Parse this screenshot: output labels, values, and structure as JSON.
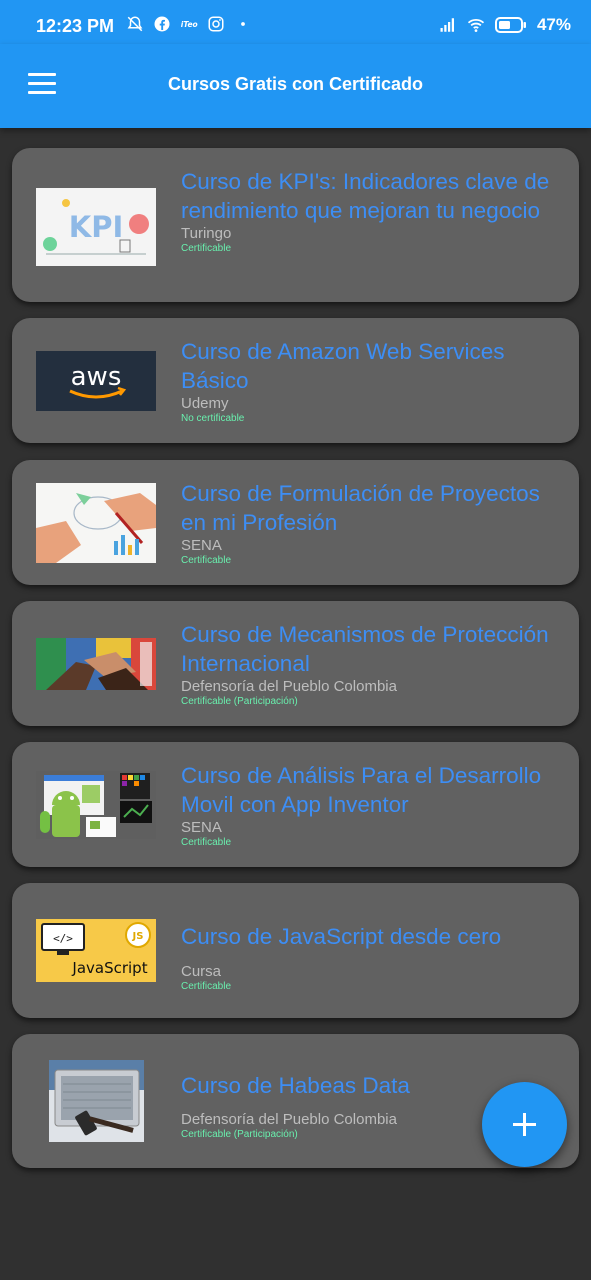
{
  "status_bar": {
    "time": "12:23 PM",
    "left_icons": [
      "notifications-off-icon",
      "facebook-icon",
      "app-notification-icon",
      "instagram-icon",
      "dot-icon"
    ],
    "right_icons": [
      "signal-icon",
      "wifi-icon",
      "battery-icon"
    ],
    "battery": "47%"
  },
  "app_bar": {
    "title": "Cursos Gratis con Certificado",
    "menu_icon": "menu-icon"
  },
  "courses": [
    {
      "title": "Curso de KPI's: Indicadores clave de rendimiento que mejoran tu negocio",
      "provider": "Turingo",
      "certification": "Certificable",
      "thumbnail_text": "KPI"
    },
    {
      "title": "Curso de Amazon Web Services Básico",
      "provider": "Udemy",
      "certification": "No certificable",
      "thumbnail_text": "aws"
    },
    {
      "title": "Curso de Formulación de Proyectos en mi Profesión",
      "provider": "SENA",
      "certification": "Certificable"
    },
    {
      "title": "Curso de Mecanismos de Protección Internacional",
      "provider": "Defensoría del Pueblo Colombia",
      "certification": "Certificable (Participación)"
    },
    {
      "title": "Curso de Análisis Para el Desarrollo Movil con App Inventor",
      "provider": "SENA",
      "certification": "Certificable"
    },
    {
      "title": "Curso de JavaScript desde cero",
      "provider": "Cursa",
      "certification": "Certificable",
      "thumbnail_text": "JavaScript",
      "thumbnail_badge": "JS"
    },
    {
      "title": "Curso de Habeas Data",
      "provider": "Defensoría del Pueblo Colombia",
      "certification": "Certificable (Participación)"
    }
  ],
  "fab": {
    "icon": "plus-icon"
  },
  "colors": {
    "primary": "#2196f3",
    "background": "#303030",
    "card": "#616161",
    "title_link": "#3d8ef5",
    "certification": "#69f0ae"
  }
}
